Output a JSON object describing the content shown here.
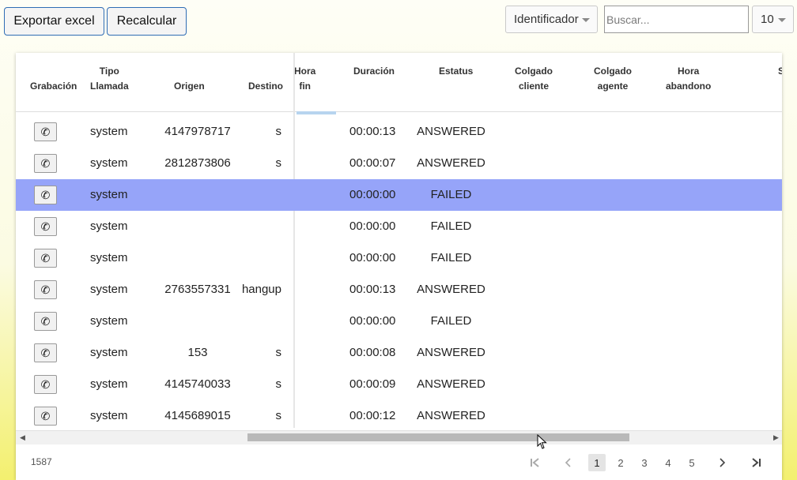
{
  "toolbar": {
    "export_label": "Exportar excel",
    "recalc_label": "Recalcular",
    "field_select": "Identificador",
    "search_placeholder": "Buscar...",
    "page_size": "10"
  },
  "table": {
    "headers": {
      "grabacion": "Grabación",
      "tipo": "Tipo\nLlamada",
      "origen": "Origen",
      "destino": "Destino",
      "hora_fin": "Hora\nfin",
      "duracion": "Duración",
      "estatus": "Estatus",
      "colgado_cliente": "Colgado\ncliente",
      "colgado_agente": "Colgado\nagente",
      "hora_abandono": "Hora\nabandono",
      "next": "S"
    },
    "rows": [
      {
        "tipo": "system",
        "origen": "4147978717",
        "destino": "s",
        "duracion": "00:00:13",
        "estatus": "ANSWERED",
        "selected": false
      },
      {
        "tipo": "system",
        "origen": "2812873806",
        "destino": "s",
        "duracion": "00:00:07",
        "estatus": "ANSWERED",
        "selected": false
      },
      {
        "tipo": "system",
        "origen": "",
        "destino": "",
        "duracion": "00:00:00",
        "estatus": "FAILED",
        "selected": true
      },
      {
        "tipo": "system",
        "origen": "",
        "destino": "",
        "duracion": "00:00:00",
        "estatus": "FAILED",
        "selected": false
      },
      {
        "tipo": "system",
        "origen": "",
        "destino": "",
        "duracion": "00:00:00",
        "estatus": "FAILED",
        "selected": false
      },
      {
        "tipo": "system",
        "origen": "2763557331",
        "destino": "hangup",
        "duracion": "00:00:13",
        "estatus": "ANSWERED",
        "selected": false
      },
      {
        "tipo": "system",
        "origen": "",
        "destino": "",
        "duracion": "00:00:00",
        "estatus": "FAILED",
        "selected": false
      },
      {
        "tipo": "system",
        "origen": "153",
        "destino": "s",
        "duracion": "00:00:08",
        "estatus": "ANSWERED",
        "selected": false
      },
      {
        "tipo": "system",
        "origen": "4145740033",
        "destino": "s",
        "duracion": "00:00:09",
        "estatus": "ANSWERED",
        "selected": false
      },
      {
        "tipo": "system",
        "origen": "4145689015",
        "destino": "s",
        "duracion": "00:00:12",
        "estatus": "ANSWERED",
        "selected": false
      }
    ]
  },
  "footer": {
    "total": "1587",
    "pages": [
      "1",
      "2",
      "3",
      "4",
      "5"
    ],
    "current_page": "1"
  },
  "colors": {
    "selected_row": "#96a4f9",
    "button_border": "#2f6db5"
  }
}
